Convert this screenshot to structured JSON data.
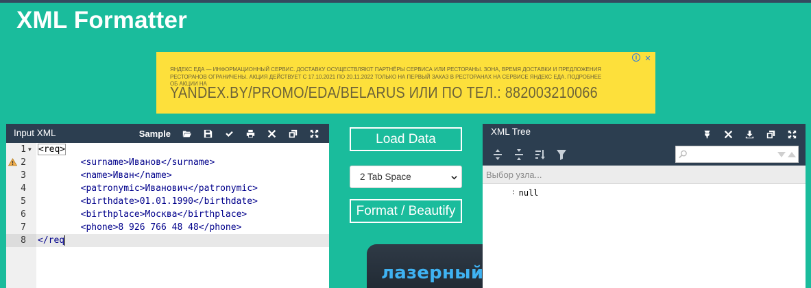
{
  "app": {
    "title": "XML Formatter"
  },
  "colors": {
    "background": "#1abc9c",
    "panel_header": "#2c3e50",
    "ad_background": "#fde03b",
    "promo_text": "#3fb2f2"
  },
  "ad": {
    "small_text": "ЯНДЕКС ЕДА — ИНФОРМАЦИОННЫЙ СЕРВИС. ДОСТАВКУ ОСУЩЕСТВЛЯЮТ ПАРТНЁРЫ СЕРВИСА ИЛИ РЕСТОРАНЫ. ЗОНА, ВРЕМЯ ДОСТАВКИ И ПРЕДЛОЖЕНИЯ РЕСТОРАНОВ ОГРАНИЧЕНЫ. АКЦИЯ ДЕЙСТВУЕТ С 17.10.2021 ПО 20.11.2022 ТОЛЬКО НА ПЕРВЫЙ ЗАКАЗ В РЕСТОРАНАХ НА СЕРВИСЕ ЯНДЕКС ЕДА. ПОДРОБНЕЕ ОБ АКЦИИ НА",
    "big_text": "YANDEX.BY/PROMO/EDA/BELARUS ИЛИ ПО ТЕЛ.: 882003210066",
    "icons": [
      "info-icon",
      "close-icon"
    ]
  },
  "input_panel": {
    "title": "Input XML",
    "sample_label": "Sample",
    "toolbar_icons": [
      "folder-open-icon",
      "save-icon",
      "check-icon",
      "print-icon",
      "clear-icon",
      "copy-icon",
      "fullscreen-icon"
    ],
    "lines": [
      {
        "num": "1",
        "text": "<req>"
      },
      {
        "num": "2",
        "text": "        <surname>Иванов</surname>"
      },
      {
        "num": "3",
        "text": "        <name>Иван</name>"
      },
      {
        "num": "4",
        "text": "        <patronymic>Иванович</patronymic>"
      },
      {
        "num": "5",
        "text": "        <birthdate>01.01.1990</birthdate>"
      },
      {
        "num": "6",
        "text": "        <birthplace>Москва</birthplace>"
      },
      {
        "num": "7",
        "text": "        <phone>8 926 766 48 48</phone>"
      },
      {
        "num": "8",
        "text": "</req"
      }
    ]
  },
  "controls": {
    "load_label": "Load Data",
    "indent_value": "2 Tab Space",
    "format_label": "Format / Beautify"
  },
  "promo": {
    "text": "лазерный"
  },
  "tree_panel": {
    "title": "XML Tree",
    "toolbar_icons": [
      "filter-funnel-icon",
      "clear-icon",
      "download-icon",
      "copy-icon",
      "fullscreen-icon"
    ],
    "tools2": [
      "expand-all-icon",
      "collapse-all-icon",
      "sort-icon",
      "filter-icon"
    ],
    "search_placeholder": "",
    "nav_text": "Выбор узла...",
    "root_sep": ":",
    "root_value": "null"
  }
}
